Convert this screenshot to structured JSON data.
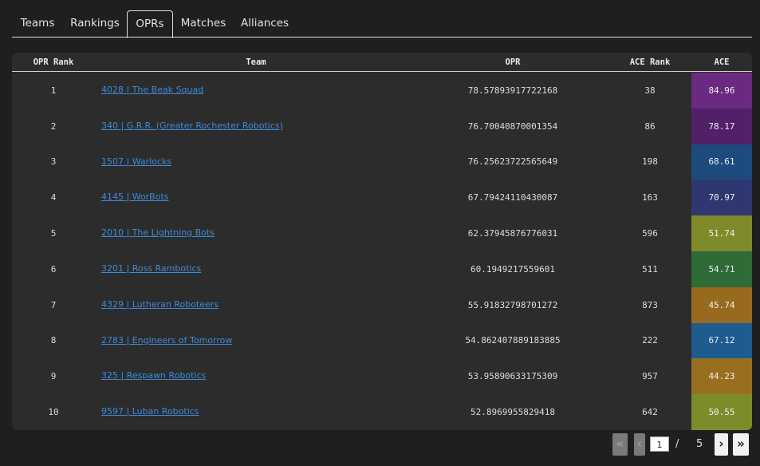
{
  "tabs": [
    {
      "label": "Teams",
      "active": false
    },
    {
      "label": "Rankings",
      "active": false
    },
    {
      "label": "OPRs",
      "active": true
    },
    {
      "label": "Matches",
      "active": false
    },
    {
      "label": "Alliances",
      "active": false
    }
  ],
  "table": {
    "headers": {
      "opr_rank": "OPR Rank",
      "team": "Team",
      "opr": "OPR",
      "ace_rank": "ACE Rank",
      "ace": "ACE"
    },
    "rows": [
      {
        "opr_rank": "1",
        "team": "4028 | The Beak Squad",
        "opr": "78.57893917722168",
        "ace_rank": "38",
        "ace": "84.96",
        "ace_color": "#6a2a80"
      },
      {
        "opr_rank": "2",
        "team": "340 | G.R.R. (Greater Rochester Robotics)",
        "opr": "76.70040870001354",
        "ace_rank": "86",
        "ace": "78.17",
        "ace_color": "#522068"
      },
      {
        "opr_rank": "3",
        "team": "1507 | Warlocks",
        "opr": "76.25623722565649",
        "ace_rank": "198",
        "ace": "68.61",
        "ace_color": "#1d4b7e"
      },
      {
        "opr_rank": "4",
        "team": "4145 | WorBots",
        "opr": "67.79424110430087",
        "ace_rank": "163",
        "ace": "70.97",
        "ace_color": "#2f3770"
      },
      {
        "opr_rank": "5",
        "team": "2010 | The Lightning Bots",
        "opr": "62.37945876776031",
        "ace_rank": "596",
        "ace": "51.74",
        "ace_color": "#7f8a2c"
      },
      {
        "opr_rank": "6",
        "team": "3201 | Ross Rambotics",
        "opr": "60.1949217559601",
        "ace_rank": "511",
        "ace": "54.71",
        "ace_color": "#2f6b36"
      },
      {
        "opr_rank": "7",
        "team": "4329 | Lutheran Roboteers",
        "opr": "55.91832798701272",
        "ace_rank": "873",
        "ace": "45.74",
        "ace_color": "#976a1f"
      },
      {
        "opr_rank": "8",
        "team": "2783 | Engineers of Tomorrow",
        "opr": "54.862407889183885",
        "ace_rank": "222",
        "ace": "67.12",
        "ace_color": "#1e5b8f"
      },
      {
        "opr_rank": "9",
        "team": "325 | Respawn Robotics",
        "opr": "53.95890633175309",
        "ace_rank": "957",
        "ace": "44.23",
        "ace_color": "#986f20"
      },
      {
        "opr_rank": "10",
        "team": "9597 | Luban Robotics",
        "opr": "52.8969955829418",
        "ace_rank": "642",
        "ace": "50.55",
        "ace_color": "#7d8b2b"
      }
    ]
  },
  "pagination": {
    "first_icon": "«",
    "prev_icon": "‹",
    "next_icon": "›",
    "last_icon": "»",
    "current_page": "1",
    "separator": "/",
    "total_pages": "5"
  }
}
